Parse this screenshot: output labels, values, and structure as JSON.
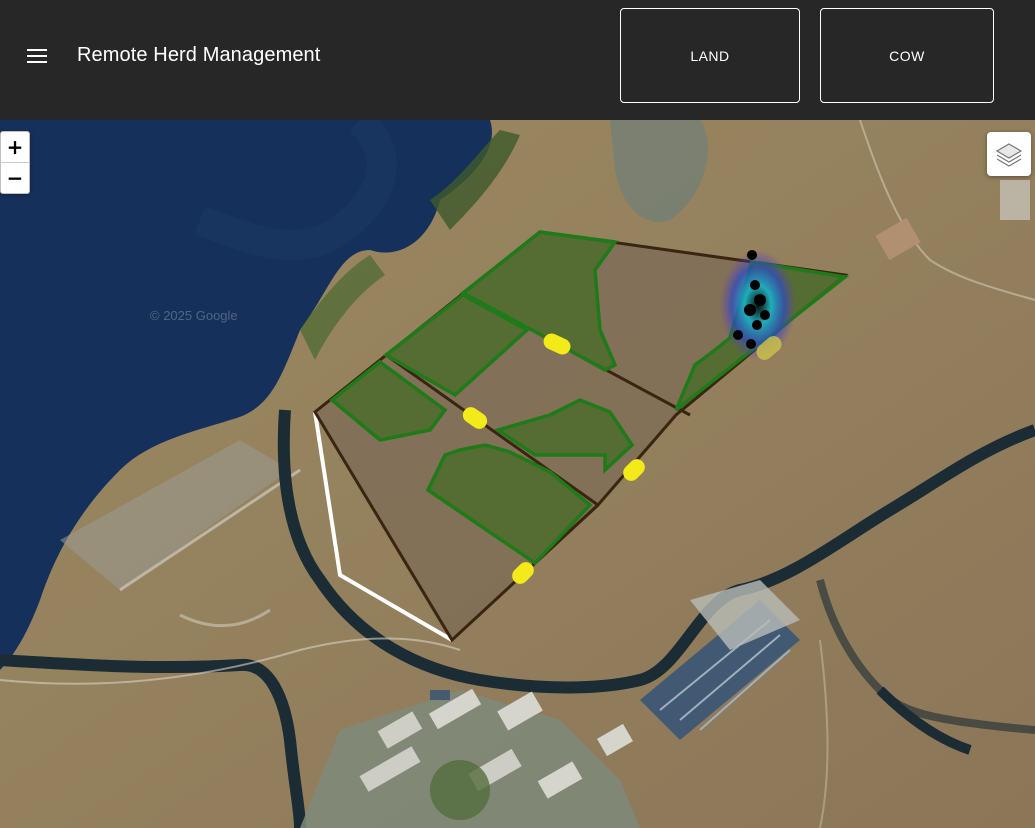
{
  "app": {
    "title": "Remote Herd Management"
  },
  "nav": {
    "land_label": "LAND",
    "cow_label": "COW"
  },
  "map": {
    "zoom_in_label": "+",
    "zoom_out_label": "−",
    "watermark": "© 2025 Google",
    "layers_icon": "layers-icon",
    "colors": {
      "paddock_fill": "#7a6a55",
      "paddock_border": "#3b2410",
      "pasture_fill": "#4a6b2a",
      "pasture_border": "#1f7a1a",
      "gate": "#f3ea1a",
      "fence": "#ffffff",
      "cow_marker": "#000000"
    }
  }
}
